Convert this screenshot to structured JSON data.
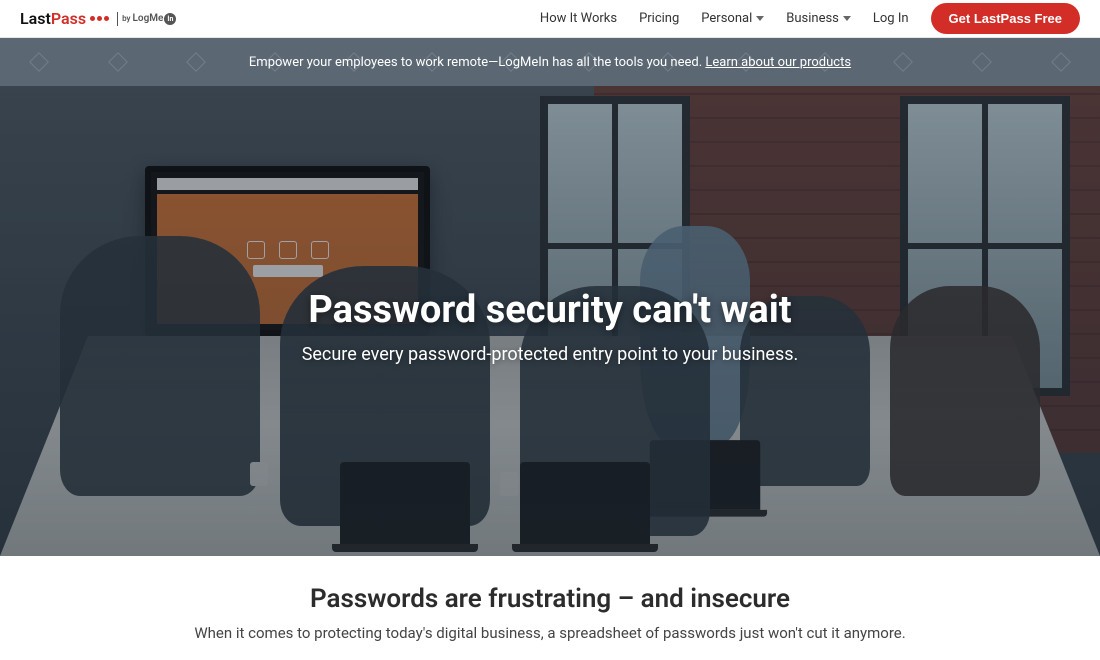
{
  "brand": {
    "part1": "Last",
    "part2": "Pass",
    "by": "by",
    "parent": "LogMe",
    "badge": "In"
  },
  "nav": {
    "items": [
      {
        "label": "How It Works",
        "dropdown": false
      },
      {
        "label": "Pricing",
        "dropdown": false
      },
      {
        "label": "Personal",
        "dropdown": true
      },
      {
        "label": "Business",
        "dropdown": true
      },
      {
        "label": "Log In",
        "dropdown": false
      }
    ],
    "cta": "Get LastPass Free"
  },
  "announce": {
    "text": "Empower your employees to work remote—LogMeIn has all the tools you need. ",
    "link": "Learn about our products"
  },
  "hero": {
    "title": "Password security can't wait",
    "subtitle": "Secure every password-protected entry point to your business."
  },
  "section2": {
    "title": "Passwords are frustrating – and insecure",
    "body": "When it comes to protecting today's digital business, a spreadsheet of passwords just won't cut it anymore."
  },
  "colors": {
    "accent": "#d32d27",
    "announceBg": "#5b6773"
  }
}
